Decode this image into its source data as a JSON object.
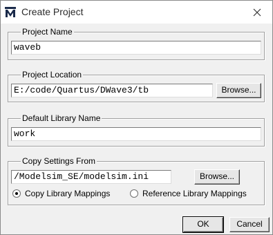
{
  "window": {
    "title": "Create Project",
    "app_icon": "modelsim-m-icon",
    "close_icon": "close-icon"
  },
  "project_name": {
    "legend": "Project Name",
    "value": "waveb"
  },
  "project_location": {
    "legend": "Project Location",
    "value": "E:/code/Quartus/DWave3/tb",
    "browse_label": "Browse..."
  },
  "default_library": {
    "legend": "Default Library Name",
    "value": "work"
  },
  "copy_settings": {
    "legend": "Copy Settings From",
    "value": "/Modelsim_SE/modelsim.ini",
    "browse_label": "Browse...",
    "options": [
      {
        "label": "Copy Library Mappings",
        "selected": true
      },
      {
        "label": "Reference Library Mappings",
        "selected": false
      }
    ]
  },
  "footer": {
    "ok_label": "OK",
    "cancel_label": "Cancel"
  }
}
